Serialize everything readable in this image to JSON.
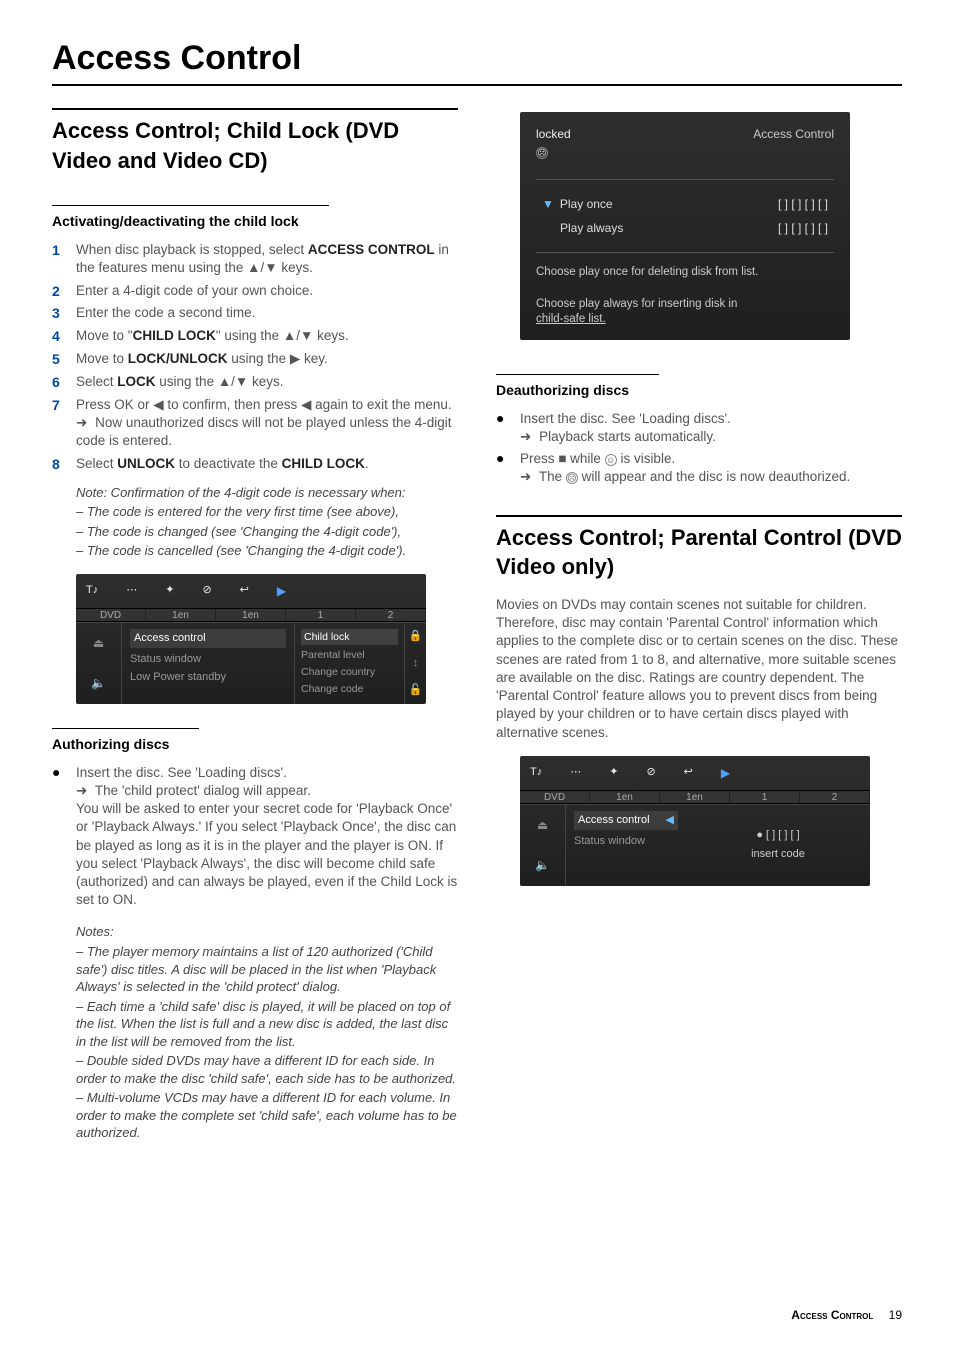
{
  "page": {
    "title": "Access Control",
    "footer_label": "Access Control",
    "footer_page": "19"
  },
  "left": {
    "section_title": "Access Control; Child Lock (DVD Video and Video CD)",
    "sub1": "Activating/deactivating the child lock",
    "steps": [
      {
        "num": "1",
        "html": "When disc playback is stopped, select <b>ACCESS CONTROL</b> in the features menu using the ▲/▼ keys."
      },
      {
        "num": "2",
        "html": "Enter a 4-digit code of your own choice."
      },
      {
        "num": "3",
        "html": "Enter the code a second time."
      },
      {
        "num": "4",
        "html": "Move to \"<b>CHILD LOCK</b>\" using the ▲/▼ keys."
      },
      {
        "num": "5",
        "html": "Move to <b>LOCK/UNLOCK</b> using the ▶ key."
      },
      {
        "num": "6",
        "html": "Select <b>LOCK</b> using the ▲/▼ keys."
      },
      {
        "num": "7",
        "html": "Press OK or ◀ to confirm, then press ◀ again to exit the menu.<br><span class=\"arrow-line\"></span> Now unauthorized discs will not be played unless the 4-digit code is entered."
      },
      {
        "num": "8",
        "html": "Select <b>UNLOCK</b> to deactivate the <b>CHILD LOCK</b>."
      }
    ],
    "note_intro": "Note: Confirmation of the 4-digit code is necessary when:",
    "note_lines": [
      "–   The code is entered for the very first time (see above),",
      "–   The code is changed (see 'Changing the 4-digit code'),",
      "–   The code is cancelled (see 'Changing the 4-digit code')."
    ],
    "ui1": {
      "strip": [
        "1en",
        "1en",
        "1",
        "2"
      ],
      "menu": [
        "Access control",
        "Status window",
        "Low Power standby"
      ],
      "submenu": [
        "Child lock",
        "Parental level",
        "Change country",
        "Change code"
      ]
    },
    "sub2": "Authorizing discs",
    "auth_bullet": "Insert the disc. See 'Loading discs'.",
    "auth_arrow": "The 'child protect' dialog will appear.",
    "auth_para": "You will be asked to enter your secret code for 'Playback Once' or 'Playback Always.' If you select 'Playback Once', the disc can be played as long as it is in the player and the player is ON. If you select 'Playback Always', the disc will become child safe (authorized) and can always be played, even if the Child Lock is set to ON.",
    "notes_label": "Notes:",
    "notes_lines": [
      "–   The player memory maintains a list of 120 authorized ('Child safe') disc titles. A disc will be placed in the list when 'Playback Always' is selected in the 'child protect' dialog.",
      "–   Each time a 'child safe' disc is played, it will be placed on top of the list. When the list is full and a new disc is added, the last disc in the list will be removed from the list.",
      "–   Double sided DVDs may have a different ID for each side. In order to make the disc 'child safe', each side has to be authorized.",
      "–   Multi-volume VCDs may have a different ID for each volume. In order to make the complete set 'child safe', each volume has to be authorized."
    ]
  },
  "right": {
    "locked": {
      "title": "locked",
      "header_right": "Access Control",
      "row1_label": "Play once",
      "row1_code": "[ ]  [ ]  [ ]  [ ]",
      "row2_label": "Play always",
      "row2_code": "[ ]  [ ]  [ ]  [ ]",
      "msg1": "Choose play once for deleting disk from list.",
      "msg2a": "Choose play always for inserting disk in",
      "msg2b": "child-safe list."
    },
    "sub_deauth": "Deauthorizing discs",
    "deauth_bullets": [
      {
        "text": "Insert the disc. See 'Loading discs'.",
        "arrow": "Playback starts automatically."
      },
      {
        "text": "Press ■ while <span class=\"safe-icon\">☺</span> is visible.",
        "arrow": "The <span class=\"safe-icon\">☹</span> will appear and the disc is now deauthorized."
      }
    ],
    "section2_title": "Access Control; Parental Control (DVD Video only)",
    "section2_para": "Movies on DVDs may contain scenes not suitable for children. Therefore, disc may contain 'Parental Control' information which applies to the complete disc or to certain scenes on the disc. These scenes are rated from 1 to 8, and alternative, more suitable scenes are available on the disc. Ratings are country dependent. The 'Parental Control' feature allows you to prevent discs from being played by your children or to have certain discs played with alternative scenes.",
    "ui2": {
      "strip": [
        "1en",
        "1en",
        "1",
        "2"
      ],
      "menu": [
        "Access control",
        "Status window"
      ],
      "code_dots": "●  [ ]  [ ]  [ ]",
      "code_hint": "insert code"
    }
  }
}
